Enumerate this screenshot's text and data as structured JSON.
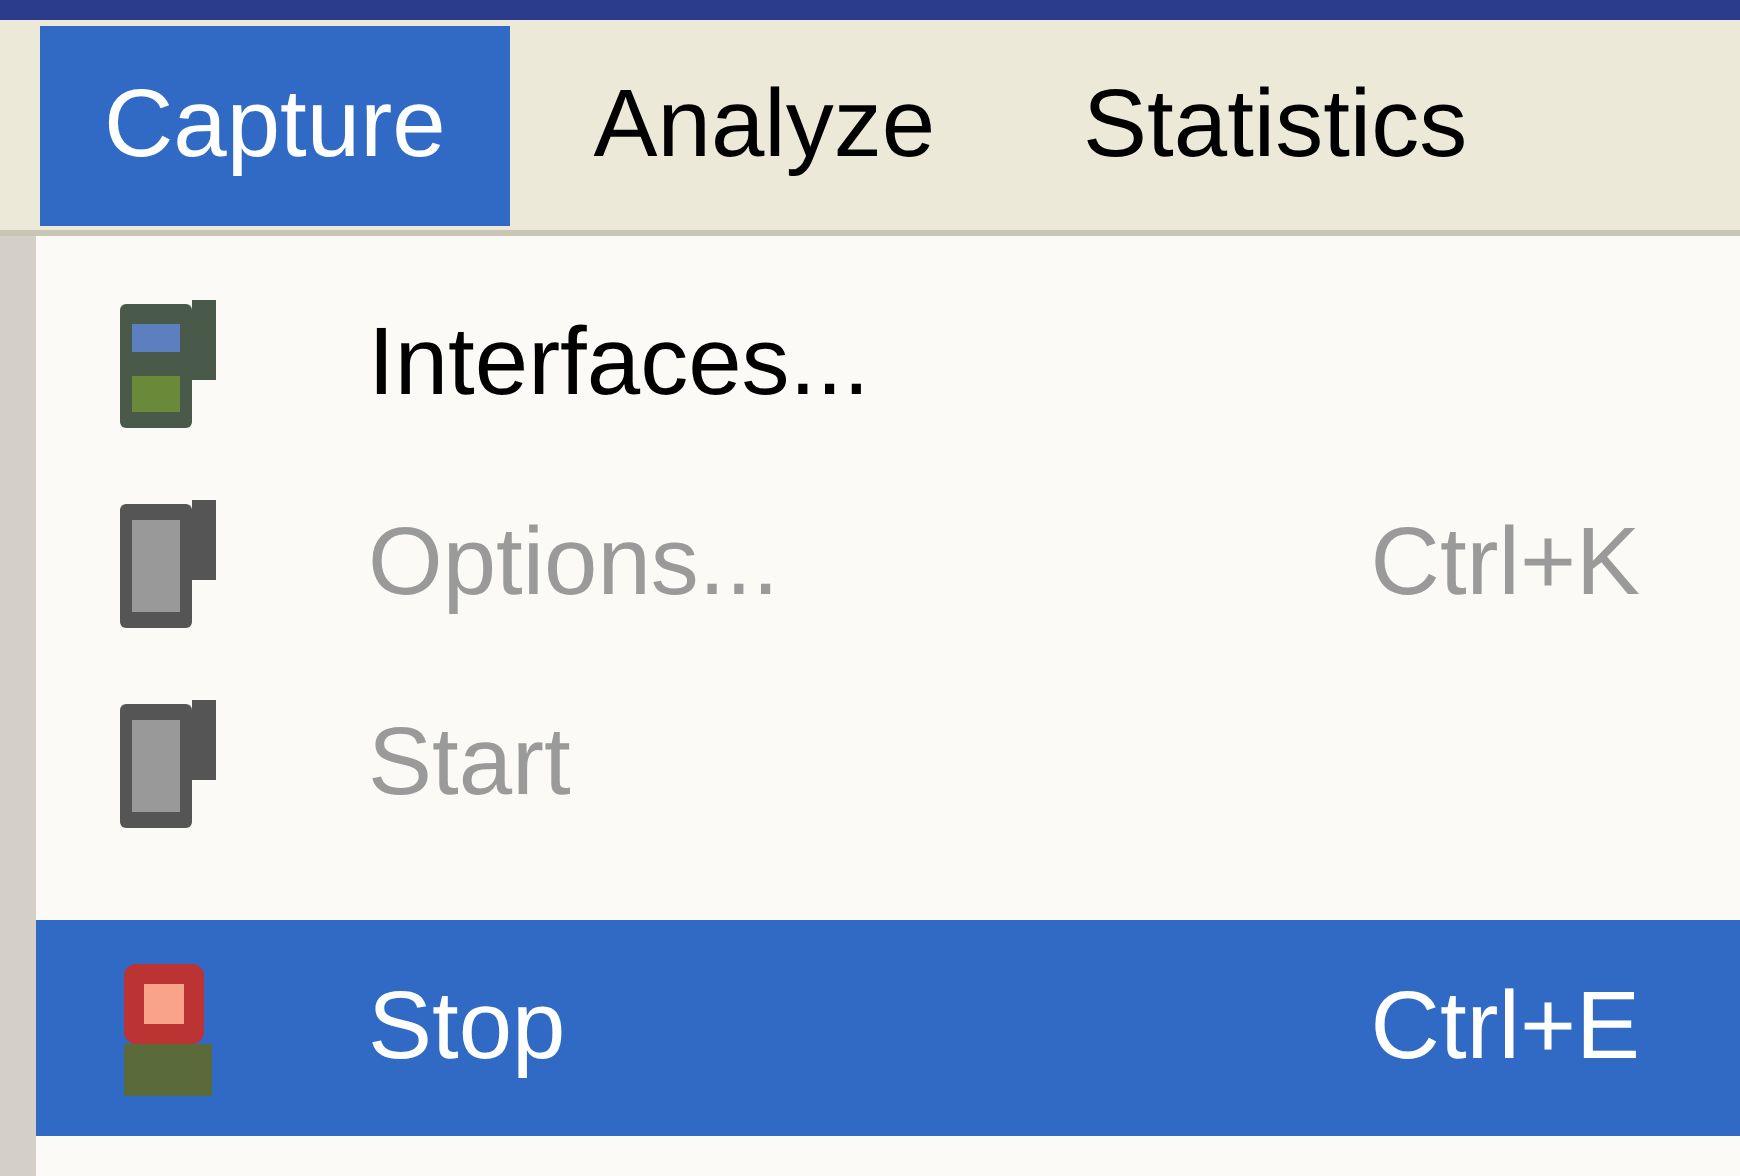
{
  "menu_bar": [
    {
      "label": "Capture",
      "selected": true
    },
    {
      "label": "Analyze",
      "selected": false
    },
    {
      "label": "Statistics",
      "selected": false
    }
  ],
  "menu": [
    {
      "label": "Interfaces...",
      "disabled": false,
      "selected": false
    },
    {
      "label": "Options...",
      "shortcut": "Ctrl+K",
      "disabled": true,
      "selected": false
    },
    {
      "label": "Start",
      "disabled": true,
      "selected": false
    },
    {
      "label": "Stop",
      "shortcut": "Ctrl+E",
      "disabled": false,
      "selected": true
    }
  ]
}
